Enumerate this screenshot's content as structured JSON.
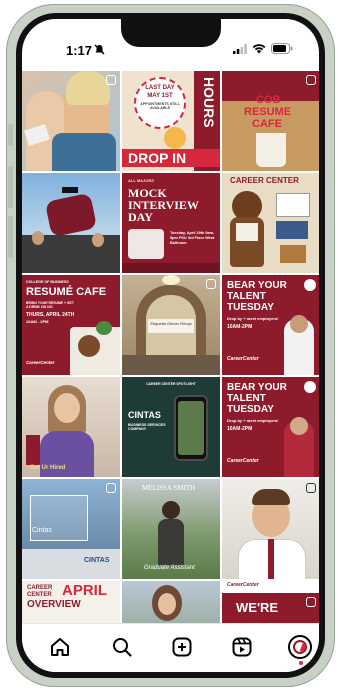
{
  "status_bar": {
    "time": "1:17"
  },
  "tiles": {
    "t2": {
      "line1": "LAST DAY",
      "line2": "MAY 1ST",
      "line3": "APPOINTMENTS STILL AVAILABLE",
      "badge1": "DROP IN",
      "badge2": "HOURS"
    },
    "t3": {
      "line1": "COB",
      "line2": "RESUME",
      "line3": "CAFE"
    },
    "t5": {
      "kicker": "ALL MAJORS",
      "line1": "MOCK",
      "line2": "INTERVIEW",
      "line3": "DAY",
      "info": "Tuesday, April 29th 9am-5pm PSU 3rd Floor West Ballroom"
    },
    "t6": {
      "line1": "CAREER CENTER"
    },
    "t7": {
      "kicker": "COLLEGE OF BUSINESS",
      "line1": "RESUMÉ CAFE",
      "info1": "BRING YOUR RESUME + GET A DRINK ON US!",
      "info2": "THURS, APRIL 24TH",
      "info3": "10AM - 2PM",
      "logo": "CareerCenter"
    },
    "t8": {
      "sign": "Etiquette Dinner Recap"
    },
    "t9": {
      "line1": "BEAR YOUR",
      "line2": "TALENT",
      "line3": "TUESDAY",
      "info": "Drop by + meet employers!",
      "info2": "10AM-2PM",
      "logo": "CareerCenter"
    },
    "t10": {
      "caption": "Get Ur Hired"
    },
    "t11": {
      "kicker": "CAREER CENTER SPOTLIGHT",
      "name": "CINTAS",
      "sub": "BUSINESS SERVICES COMPANY"
    },
    "t12": {
      "line1": "BEAR YOUR",
      "line2": "TALENT",
      "line3": "TUESDAY",
      "info": "Drop by + meet employers!",
      "info2": "10AM-2PM",
      "logo": "CareerCenter"
    },
    "t13": {
      "label": "Cintas",
      "brand": "CINTAS"
    },
    "t14": {
      "name": "MELISSA SMITH",
      "role": "Graduate Assistant"
    },
    "t16": {
      "line1": "CAREER",
      "line2": "CENTER",
      "line3": "APRIL",
      "line4": "OVERVIEW"
    },
    "t18": {
      "logo": "CareerCenter",
      "line1": "WE'RE"
    }
  },
  "nav": {
    "items": [
      "home",
      "search",
      "create",
      "reels",
      "profile"
    ]
  },
  "colors": {
    "maroon": "#8e1b2c",
    "cream": "#efe3cf",
    "accent_red": "#d6283c"
  }
}
